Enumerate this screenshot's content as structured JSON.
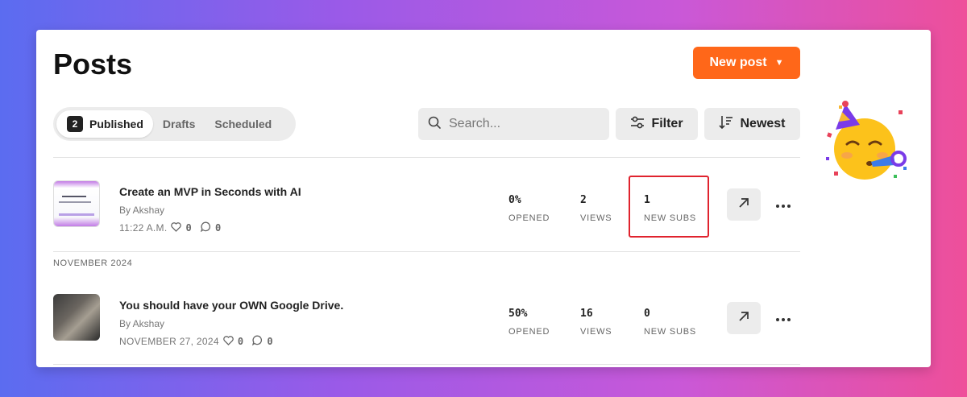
{
  "header": {
    "title": "Posts",
    "new_post_label": "New post"
  },
  "tabs": [
    {
      "label": "Published",
      "count": "2",
      "active": true
    },
    {
      "label": "Drafts",
      "active": false
    },
    {
      "label": "Scheduled",
      "active": false
    }
  ],
  "search": {
    "placeholder": "Search..."
  },
  "toolbar": {
    "filter_label": "Filter",
    "sort_label": "Newest"
  },
  "posts": [
    {
      "title": "Create an MVP in Seconds with AI",
      "author": "By Akshay",
      "date": "11:22 A.M.",
      "likes": "0",
      "comments": "0",
      "opened": "0%",
      "opened_label": "OPENED",
      "views": "2",
      "views_label": "VIEWS",
      "new_subs": "1",
      "new_subs_label": "NEW SUBS"
    },
    {
      "title": "You should have your OWN Google Drive.",
      "author": "By Akshay",
      "date": "NOVEMBER 27, 2024",
      "likes": "0",
      "comments": "0",
      "opened": "50%",
      "opened_label": "OPENED",
      "views": "16",
      "views_label": "VIEWS",
      "new_subs": "0",
      "new_subs_label": "NEW SUBS"
    }
  ],
  "sections": {
    "november": "NOVEMBER 2024"
  },
  "colors": {
    "accent": "#ff6719",
    "highlight": "#e0232e"
  },
  "icons": [
    "search-icon",
    "filter-icon",
    "sort-icon",
    "heart-icon",
    "comment-icon",
    "external-link-icon",
    "more-icon",
    "party-face-emoji"
  ]
}
